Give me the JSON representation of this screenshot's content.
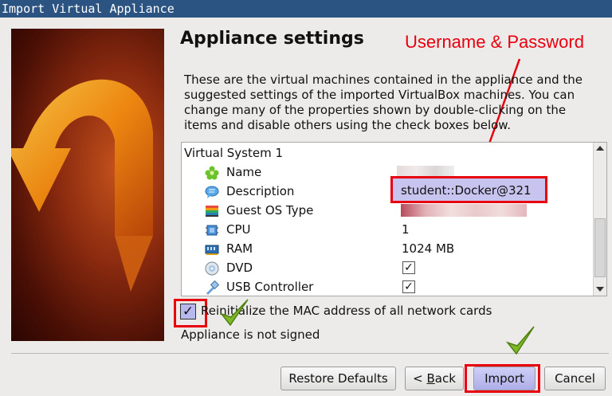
{
  "window": {
    "title": "Import Virtual Appliance"
  },
  "heading": "Appliance settings",
  "annotation": "Username & Password",
  "description": "These are the virtual machines contained in the appliance and the suggested settings of the imported VirtualBox machines. You can change many of the properties shown by double-clicking on the items and disable others using the check boxes below.",
  "tree": {
    "root": "Virtual System 1",
    "rows": [
      {
        "label": "Name",
        "value": "",
        "icon": "name-icon"
      },
      {
        "label": "Description",
        "value": "student::Docker@321",
        "icon": "description-icon"
      },
      {
        "label": "Guest OS Type",
        "value": "",
        "icon": "guest-os-icon"
      },
      {
        "label": "CPU",
        "value": "1",
        "icon": "cpu-icon"
      },
      {
        "label": "RAM",
        "value": "1024 MB",
        "icon": "ram-icon"
      },
      {
        "label": "DVD",
        "value": "✓",
        "icon": "dvd-icon"
      },
      {
        "label": "USB Controller",
        "value": "✓",
        "icon": "usb-icon"
      }
    ]
  },
  "mac_option": {
    "label": "Reinitialize the MAC address of all network cards",
    "checked": true,
    "mark": "✓"
  },
  "signed_status": "Appliance is not signed",
  "buttons": {
    "restore": "Restore Defaults",
    "back_prefix": "< ",
    "back_underlined": "B",
    "back_rest": "ack",
    "import": "Import",
    "cancel": "Cancel"
  },
  "colors": {
    "highlight_red": "#e8000f",
    "selection": "#c7c5f0",
    "titlebar": "#2b5482",
    "check_green": "#7fb826"
  }
}
